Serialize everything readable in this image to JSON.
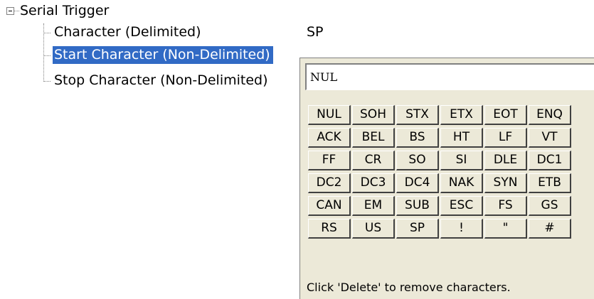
{
  "tree": {
    "root_label": "Serial Trigger",
    "items": [
      {
        "label": "Character (Delimited)",
        "value": "SP"
      },
      {
        "label": "Start Character (Non-Delimited)"
      },
      {
        "label": "Stop Character (Non-Delimited)"
      }
    ]
  },
  "popup": {
    "input_value": "NUL",
    "buttons": [
      "NUL",
      "SOH",
      "STX",
      "ETX",
      "EOT",
      "ENQ",
      "ACK",
      "BEL",
      "BS",
      "HT",
      "LF",
      "VT",
      "FF",
      "CR",
      "SO",
      "SI",
      "DLE",
      "DC1",
      "DC2",
      "DC3",
      "DC4",
      "NAK",
      "SYN",
      "ETB",
      "CAN",
      "EM",
      "SUB",
      "ESC",
      "FS",
      "GS",
      "RS",
      "US",
      "SP",
      "!",
      "\"",
      "#"
    ],
    "hint": "Click 'Delete' to remove characters."
  }
}
